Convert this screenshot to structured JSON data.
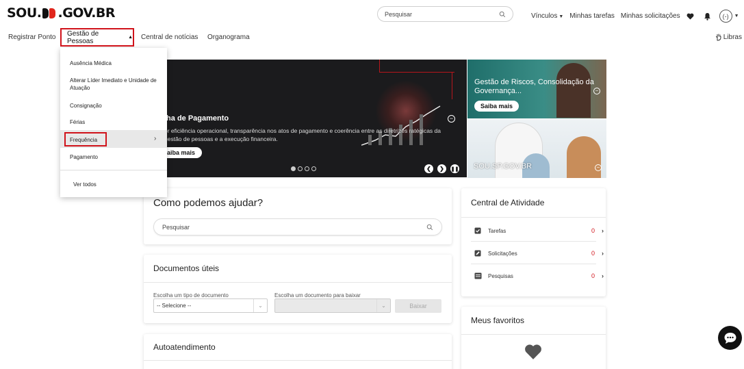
{
  "header": {
    "logo_prefix": "SOU.",
    "logo_suffix": ".GOV.BR",
    "search_placeholder": "Pesquisar",
    "links": {
      "vinculos": "Vínculos",
      "minhas_tarefas": "Minhas tarefas",
      "minhas_solicitacoes": "Minhas solicitações"
    },
    "avatar_text": "(-)"
  },
  "nav": {
    "registrar_ponto": "Registrar Ponto",
    "gestao_pessoas": "Gestão de Pessoas",
    "central_noticias": "Central de notícias",
    "organograma": "Organograma",
    "libras": "Libras"
  },
  "dropdown": {
    "items": [
      "Ausência Médica",
      "Alterar Líder Imediato e Unidade de Atuação",
      "Consignação",
      "Férias",
      "Frequência",
      "Pagamento"
    ],
    "ver_todos": "Ver todos"
  },
  "hero": {
    "title": "lha de Pagamento",
    "description": "or eficiência operacional, transparência nos atos de pagamento e coerência entre as diretrizes ratégicas da gestão de pessoas e a execução financeira.",
    "button": "aiba mais",
    "slide_count": 4,
    "active_slide": 1
  },
  "side_banner_top": {
    "text": "Gestão de Riscos, Consolidação da Governança...",
    "button": "Saiba mais"
  },
  "side_banner_bottom": {
    "text": "SOU.SP.GOV.BR"
  },
  "help": {
    "title": "Como podemos ajudar?",
    "search_placeholder": "Pesquisar"
  },
  "documents": {
    "title": "Documentos úteis",
    "type_label": "Escolha um tipo de documento",
    "type_value": "-- Selecione --",
    "doc_label": "Escolha um documento para baixar",
    "doc_value": "",
    "download_button": "Baixar"
  },
  "self_service": {
    "title": "Autoatendimento"
  },
  "activity": {
    "title": "Central de Atividade",
    "rows": [
      {
        "label": "Tarefas",
        "count": "0"
      },
      {
        "label": "Solicitações",
        "count": "0"
      },
      {
        "label": "Pesquisas",
        "count": "0"
      }
    ]
  },
  "favorites": {
    "title": "Meus favoritos"
  },
  "colors": {
    "accent_red": "#d0121a",
    "hero_bg": "#1b1b1d"
  }
}
